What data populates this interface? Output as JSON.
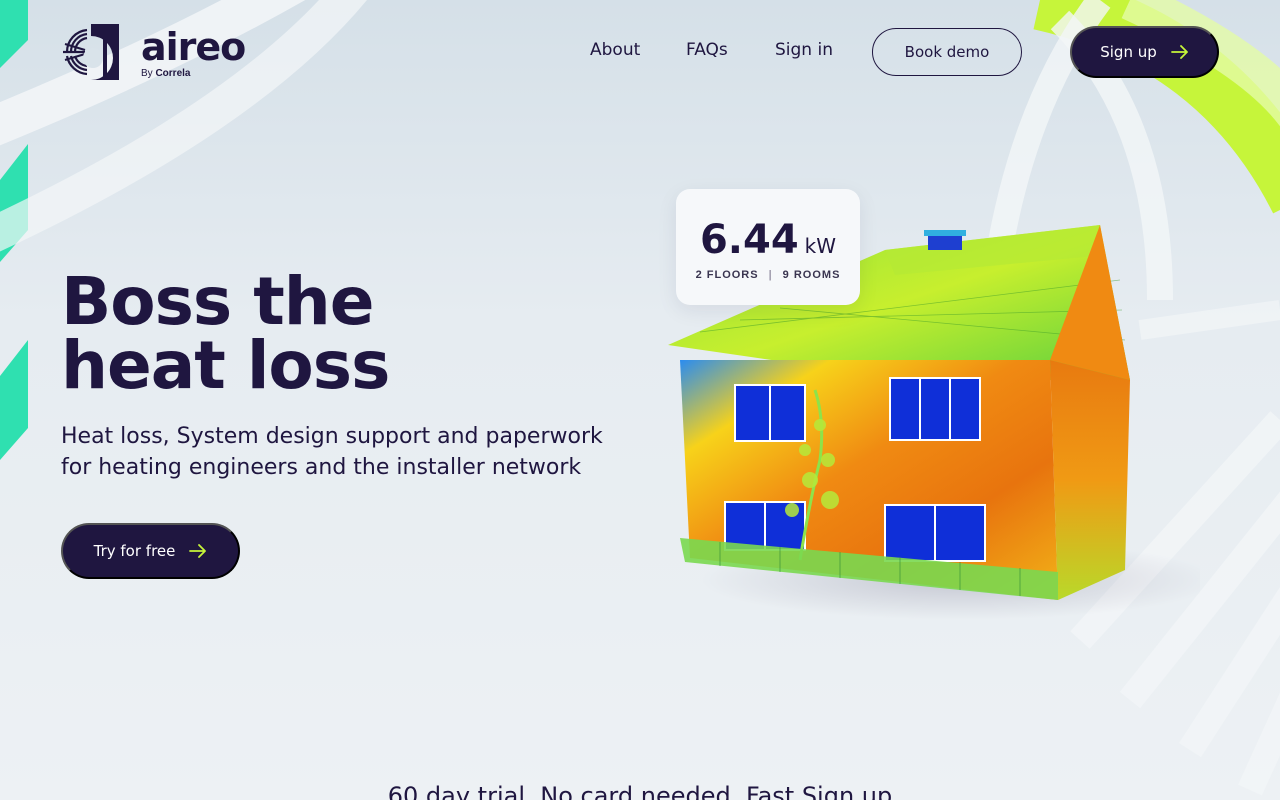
{
  "brand": {
    "name": "aireo",
    "by_prefix": "By",
    "by_name": "Correla",
    "accent_lime": "#c6f53a",
    "accent_teal": "#2fe0b0",
    "ink": "#1f1640"
  },
  "nav": {
    "about": "About",
    "faqs": "FAQs",
    "signin": "Sign in",
    "book_demo": "Book demo",
    "signup": "Sign up"
  },
  "hero": {
    "title_line1": "Boss the",
    "title_line2": "heat loss",
    "subtitle_line1": "Heat loss, System design support and paperwork",
    "subtitle_line2": "for heating engineers and the installer network",
    "cta": "Try for free"
  },
  "stat_card": {
    "value": "6.44",
    "unit": "kW",
    "floors": "2 FLOORS",
    "separator": "|",
    "rooms": "9 ROOMS"
  },
  "trial_banner": "60 day trial. No card needed. Fast Sign up",
  "icons": {
    "logo": "aireo-logo-mark",
    "arrow": "arrow-right-icon"
  }
}
